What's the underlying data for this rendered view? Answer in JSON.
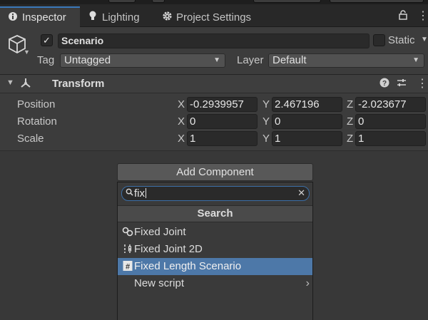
{
  "tabs": {
    "inspector": "Inspector",
    "lighting": "Lighting",
    "project_settings": "Project Settings"
  },
  "icons": {
    "inspector": "info-icon",
    "lighting": "lightbulb-icon",
    "project_settings": "gear-icon",
    "lock": "lock-icon",
    "menu": "kebab-menu-icon",
    "object": "cube-icon",
    "transform": "transform-axes-icon",
    "help": "help-icon",
    "presets": "sliders-icon",
    "search": "search-icon",
    "clear": "close-icon",
    "fixed_joint": "link-icon",
    "fixed_joint_2d": "link-2d-icon",
    "script": "hash-icon",
    "submenu": "chevron-right-icon"
  },
  "object": {
    "active": true,
    "name": "Scenario",
    "static_label": "Static",
    "tag_label": "Tag",
    "tag_value": "Untagged",
    "layer_label": "Layer",
    "layer_value": "Default"
  },
  "transform": {
    "title": "Transform",
    "rows": [
      {
        "label": "Position",
        "x": "-0.2939957",
        "y": "2.467196",
        "z": "-2.023677"
      },
      {
        "label": "Rotation",
        "x": "0",
        "y": "0",
        "z": "0"
      },
      {
        "label": "Scale",
        "x": "1",
        "y": "1",
        "z": "1"
      }
    ],
    "axes": {
      "x": "X",
      "y": "Y",
      "z": "Z"
    }
  },
  "add_component": {
    "button_label": "Add Component",
    "search_value": "fix",
    "list_title": "Search",
    "items": [
      {
        "label": "Fixed Joint",
        "selected": false
      },
      {
        "label": "Fixed Joint 2D",
        "selected": false
      },
      {
        "label": "Fixed Length Scenario",
        "selected": true
      },
      {
        "label": "New script",
        "selected": false,
        "has_submenu": true
      }
    ]
  },
  "colors": {
    "accent": "#3a79bb",
    "selection": "#4d78a8",
    "panel": "#3c3c3c"
  }
}
